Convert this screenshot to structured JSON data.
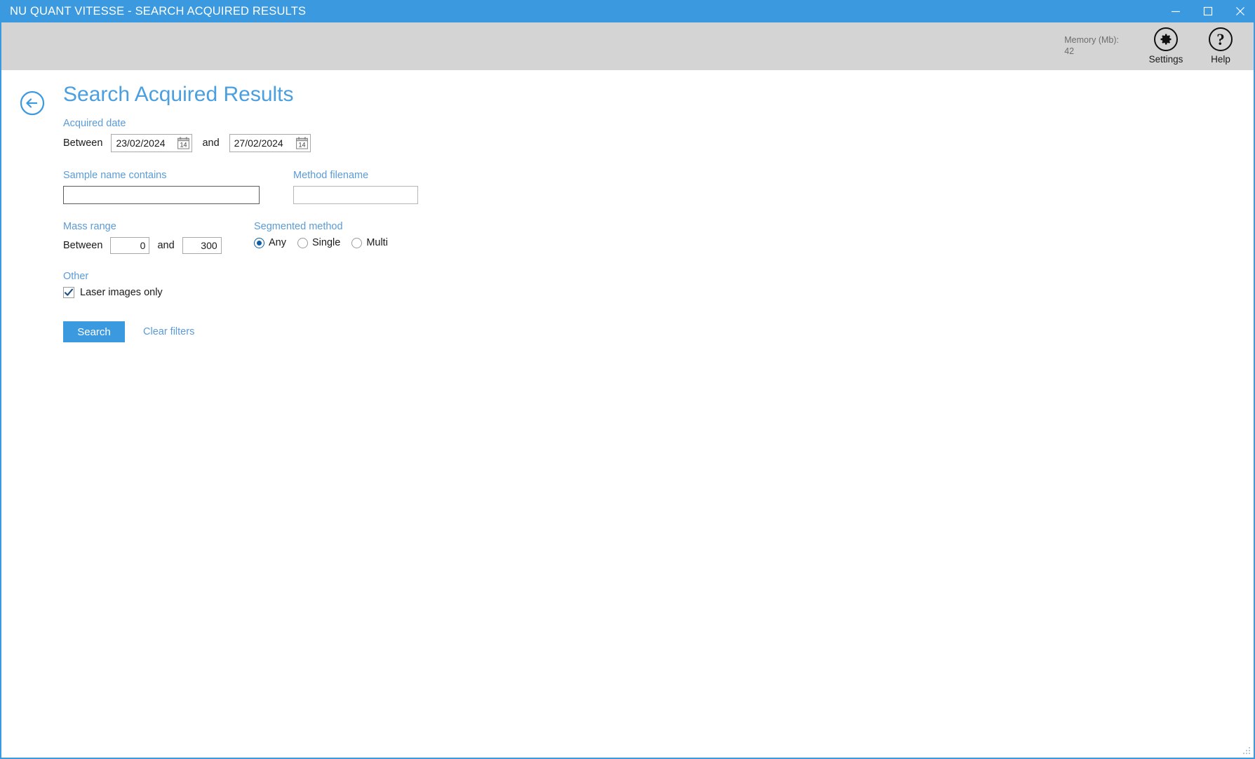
{
  "window": {
    "title": "NU QUANT VITESSE - SEARCH ACQUIRED RESULTS",
    "minimize_label": "minimize-icon",
    "maximize_label": "maximize-icon",
    "close_label": "close-icon",
    "accent_color": "#3b99e0",
    "toolbar_color": "#d4d4d4"
  },
  "toolbar": {
    "memory_label": "Memory (Mb):",
    "memory_value": "42",
    "settings_label": "Settings",
    "settings_icon": "gear-icon",
    "help_label": "Help",
    "help_icon": "question-mark-icon"
  },
  "page": {
    "back_icon": "back-arrow-icon",
    "title": "Search Acquired Results"
  },
  "filters": {
    "acquired_date": {
      "label": "Acquired date",
      "between_label": "Between",
      "and_label": "and",
      "from_value": "23/02/2024",
      "to_value": "27/02/2024",
      "calendar_icon": "calendar-icon",
      "calendar_day": "14"
    },
    "sample_name": {
      "label": "Sample name contains",
      "value": "",
      "placeholder": ""
    },
    "method_filename": {
      "label": "Method filename",
      "value": "",
      "placeholder": ""
    },
    "mass_range": {
      "label": "Mass range",
      "between_label": "Between",
      "and_label": "and",
      "min_value": "0",
      "max_value": "300"
    },
    "segmented_method": {
      "label": "Segmented method",
      "selected": "Any",
      "options": [
        {
          "label": "Any",
          "selected": true
        },
        {
          "label": "Single",
          "selected": false
        },
        {
          "label": "Multi",
          "selected": false
        }
      ]
    },
    "other": {
      "label": "Other",
      "laser_images_only_label": "Laser images only",
      "laser_images_only_checked": true
    }
  },
  "actions": {
    "search_label": "Search",
    "clear_filters_label": "Clear filters"
  }
}
